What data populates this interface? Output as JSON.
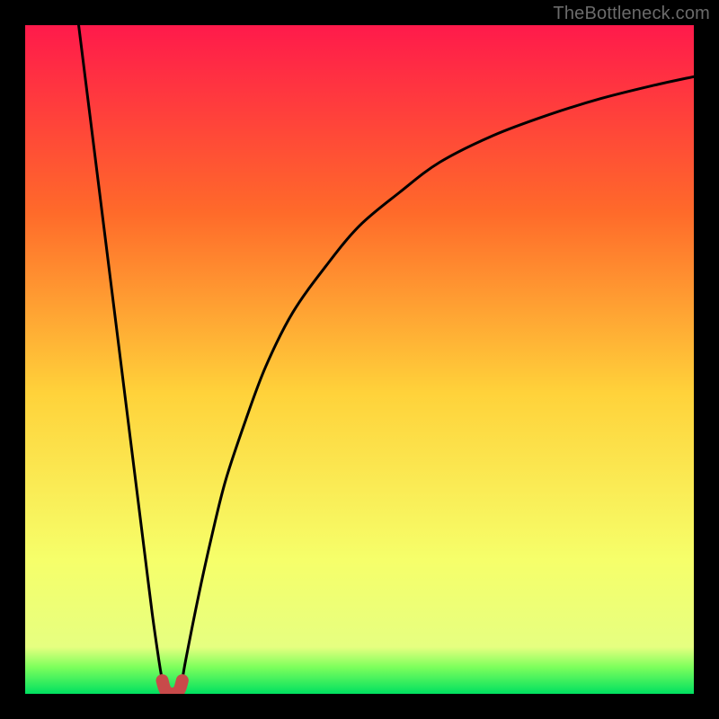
{
  "watermark": "TheBottleneck.com",
  "chart_data": {
    "type": "line",
    "title": "",
    "xlabel": "",
    "ylabel": "",
    "xlim": [
      0,
      100
    ],
    "ylim": [
      0,
      100
    ],
    "grid": false,
    "legend": false,
    "annotations": [],
    "background_gradient": {
      "top": "#ff1a4b",
      "mid_upper": "#ff6a2a",
      "mid": "#ffd23a",
      "mid_lower": "#f6ff6a",
      "green_band": "#7dff5c",
      "bottom": "#00e060"
    },
    "series": [
      {
        "name": "left-branch",
        "stroke": "#000000",
        "x": [
          8,
          9,
          10,
          11,
          12,
          13,
          14,
          15,
          16,
          17,
          18,
          19,
          20,
          20.5
        ],
        "y": [
          100,
          92,
          84,
          76,
          68,
          60,
          52,
          44,
          36,
          28,
          20,
          12,
          5,
          2
        ]
      },
      {
        "name": "right-branch",
        "stroke": "#000000",
        "x": [
          23.5,
          24,
          26,
          28,
          30,
          33,
          36,
          40,
          45,
          50,
          56,
          62,
          70,
          78,
          86,
          94,
          100
        ],
        "y": [
          2,
          5,
          15,
          24,
          32,
          41,
          49,
          57,
          64,
          70,
          75,
          79.5,
          83.5,
          86.5,
          89,
          91,
          92.3
        ]
      },
      {
        "name": "valley-marker",
        "stroke": "#c84a4a",
        "x": [
          20.5,
          21,
          22,
          23,
          23.5
        ],
        "y": [
          2,
          0.5,
          0,
          0.5,
          2
        ]
      }
    ]
  }
}
